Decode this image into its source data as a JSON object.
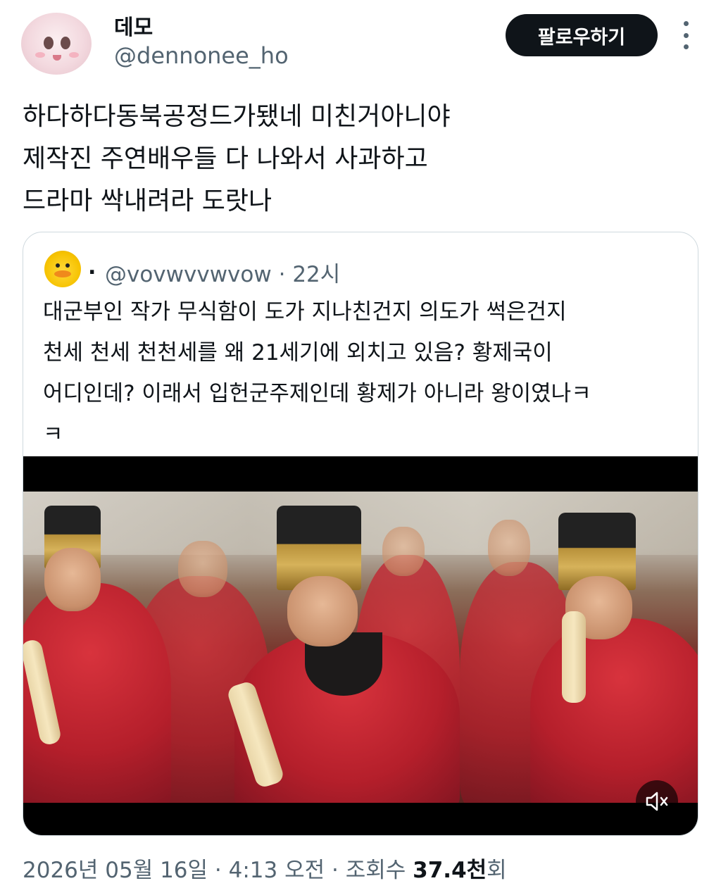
{
  "author": {
    "display_name": "데모",
    "handle": "@dennonee_ho",
    "avatar_icon": "avatar-character-icon"
  },
  "follow_button": {
    "label": "팔로우하기"
  },
  "more_icon": "more-options-icon",
  "tweet": {
    "text": "하다하다동북공정드가됐네 미친거아니야\n제작진 주연배우들 다 나와서 사과하고\n드라마 싹내려라 도랏나"
  },
  "quoted_tweet": {
    "display_name": ".",
    "handle": "@vovwvvwvow",
    "separator": "·",
    "time": "22시",
    "text": "대군부인 작가 무식함이 도가 지나친건지 의도가 썩은건지\n천세 천세 천천세를 왜 21세기에 외치고 있음? 황제국이\n어디인데? 이래서 입헌군주제인데 황제가 아니라 왕이였나ㅋ\nㅋ",
    "media": {
      "type": "video",
      "mute_icon": "mute-speaker-icon"
    }
  },
  "footer": {
    "date": "2026년 05월 16일",
    "dot1": "·",
    "time": "4:13 오전",
    "dot2": "·",
    "views_label": "조회수",
    "views_count": "37.4천",
    "views_suffix": "회"
  }
}
